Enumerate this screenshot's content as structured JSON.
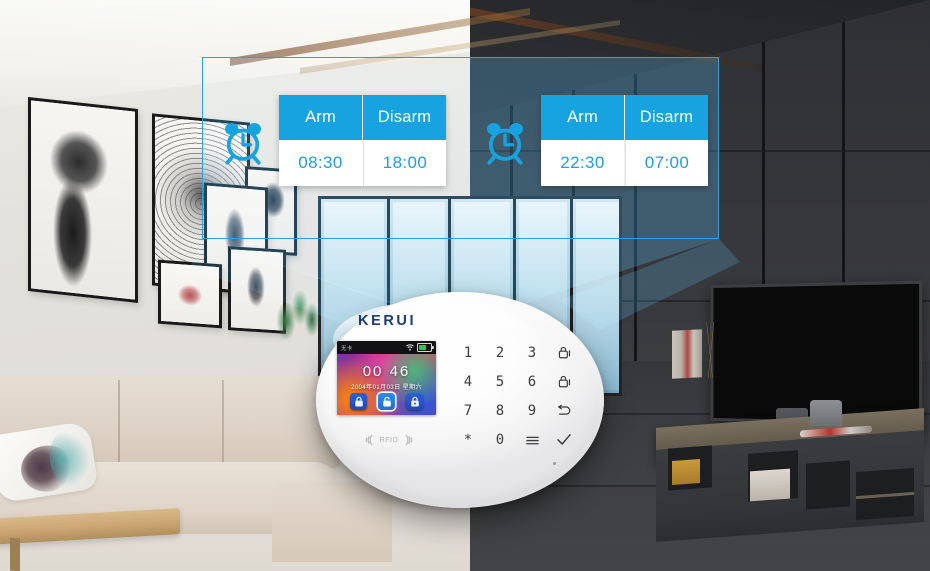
{
  "scene": {
    "title": "KERUI smart alarm panel scheduled arm and disarm",
    "accent_blue": "#16a3e0",
    "frame_blue": "#2aa0e2",
    "logo_navy": "#1b3a75"
  },
  "schedules": [
    {
      "id": "daytime-schedule",
      "icon": "alarm-clock-icon",
      "columns": [
        {
          "header": "Arm",
          "time": "08:30"
        },
        {
          "header": "Disarm",
          "time": "18:00"
        }
      ]
    },
    {
      "id": "nighttime-schedule",
      "icon": "alarm-clock-icon",
      "columns": [
        {
          "header": "Arm",
          "time": "22:30"
        },
        {
          "header": "Disarm",
          "time": "07:00"
        }
      ]
    }
  ],
  "device": {
    "brand": "KERUI",
    "rfid_label": "RFID",
    "lcd": {
      "signal_text": "无卡",
      "wifi_icon": "wifi-icon",
      "battery_icon": "battery-icon",
      "time": "00 46",
      "date": "2004年01月03日 星期六",
      "modes": [
        {
          "name": "arm-away",
          "icon": "lock-closed-icon",
          "active": false
        },
        {
          "name": "disarm",
          "icon": "lock-open-icon",
          "active": true
        },
        {
          "name": "arm-home",
          "icon": "lock-home-icon",
          "active": false
        }
      ]
    },
    "keypad": [
      {
        "label": "1",
        "name": "key-1",
        "icon": null
      },
      {
        "label": "2",
        "name": "key-2",
        "icon": null
      },
      {
        "label": "3",
        "name": "key-3",
        "icon": null
      },
      {
        "label": "",
        "name": "key-arm-away",
        "icon": "lock-closed-icon"
      },
      {
        "label": "4",
        "name": "key-4",
        "icon": null
      },
      {
        "label": "5",
        "name": "key-5",
        "icon": null
      },
      {
        "label": "6",
        "name": "key-6",
        "icon": null
      },
      {
        "label": "",
        "name": "key-arm-home",
        "icon": "lock-closed-icon"
      },
      {
        "label": "7",
        "name": "key-7",
        "icon": null
      },
      {
        "label": "8",
        "name": "key-8",
        "icon": null
      },
      {
        "label": "9",
        "name": "key-9",
        "icon": null
      },
      {
        "label": "",
        "name": "key-back",
        "icon": "back-arrow-icon"
      },
      {
        "label": "*",
        "name": "key-star",
        "icon": null
      },
      {
        "label": "0",
        "name": "key-0",
        "icon": null
      },
      {
        "label": "",
        "name": "key-menu",
        "icon": "menu-icon"
      },
      {
        "label": "",
        "name": "key-confirm",
        "icon": "check-icon"
      }
    ]
  }
}
